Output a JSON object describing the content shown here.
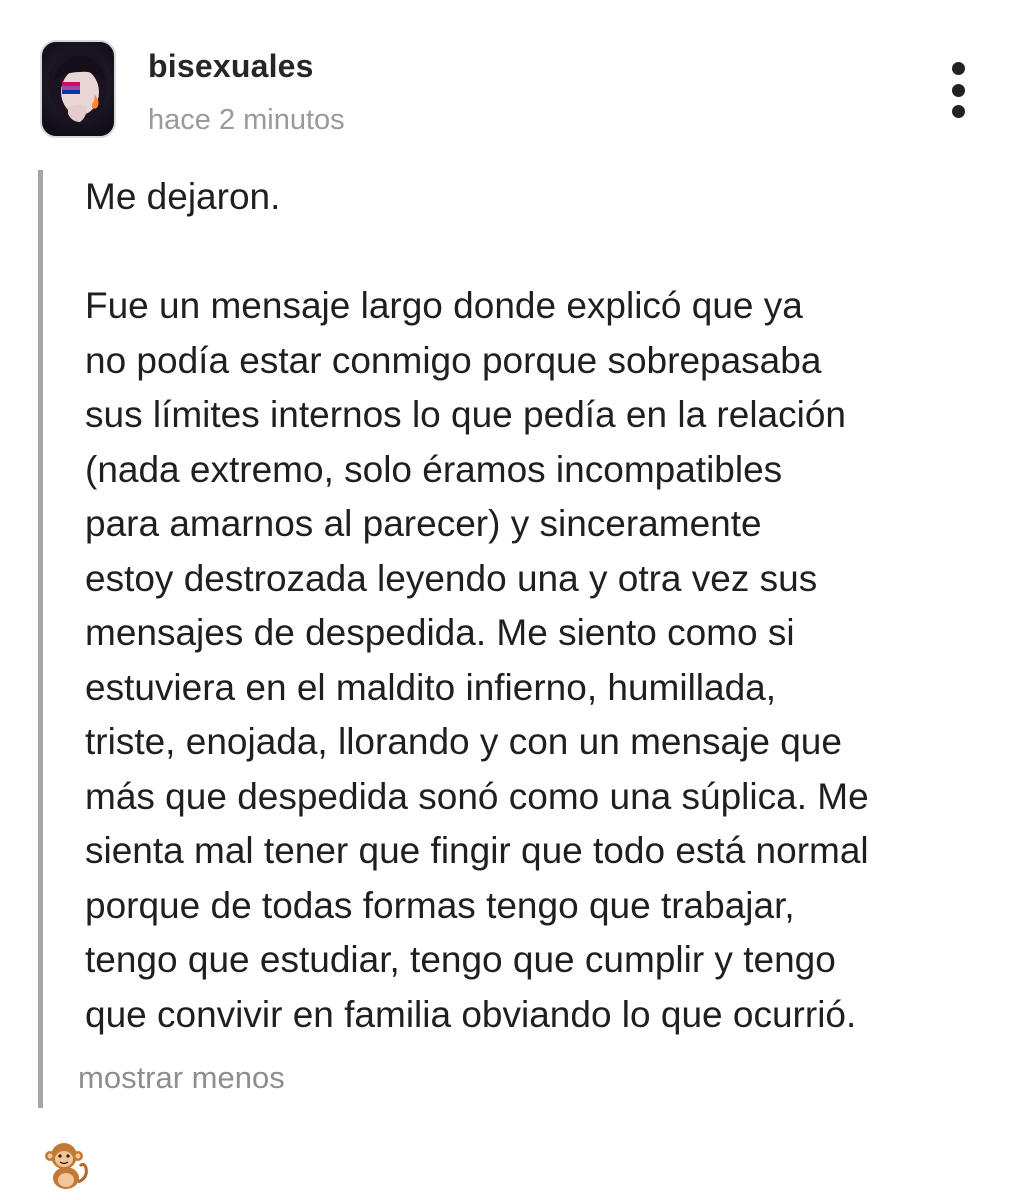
{
  "post": {
    "username": "bisexuales",
    "timestamp": "hace 2 minutos",
    "title_line": "Me dejaron.",
    "body_lines": [
      "Fue un mensaje largo donde explicó que ya",
      "no podía estar conmigo porque sobrepasaba",
      "sus límites internos lo que pedía en la relación",
      "(nada extremo, solo éramos incompatibles",
      "para amarnos al parecer) y sinceramente",
      "estoy destrozada leyendo una y otra vez sus",
      "mensajes de despedida. Me siento como si",
      "estuviera en el maldito infierno, humillada,",
      "triste, enojada, llorando y con un mensaje que",
      "más que despedida sonó como una súplica. Me",
      "sienta mal tener que fingir que todo está normal",
      "porque de todas formas tengo que trabajar,",
      "tengo que estudiar, tengo que cumplir y tengo",
      "que convivir en familia obviando lo que ocurrió."
    ],
    "show_less_label": "mostrar menos"
  },
  "icons": {
    "more": "more-vertical-icon",
    "footer": "monkey-emoji-icon"
  },
  "colors": {
    "text": "#1f1f1f",
    "muted": "#9a9a9a",
    "quote_bar": "#a6a6a6",
    "background": "#ffffff"
  }
}
